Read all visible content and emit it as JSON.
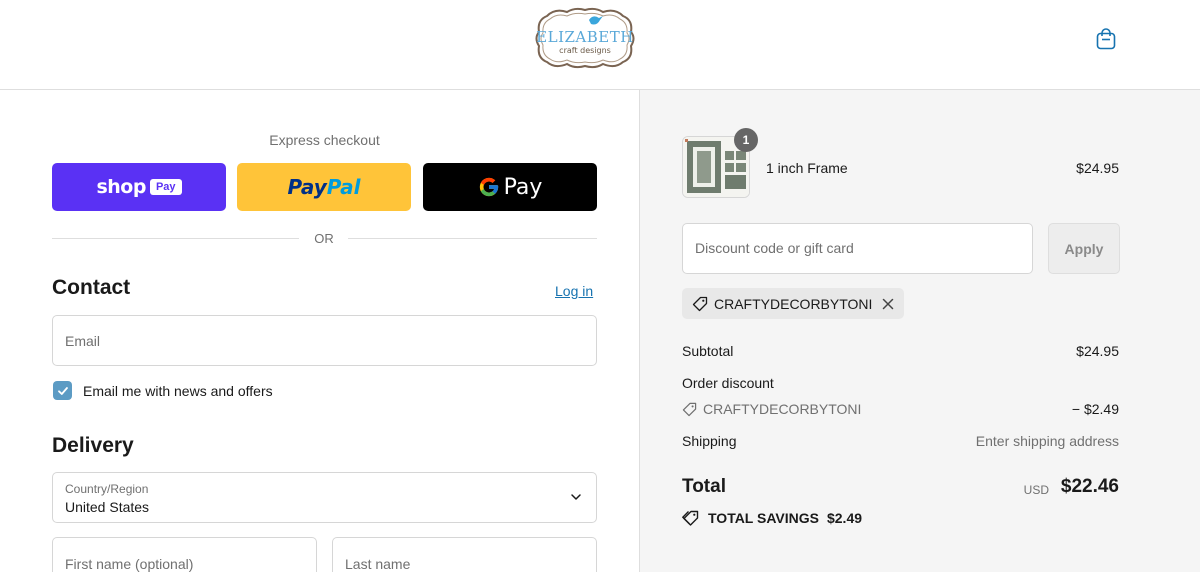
{
  "header": {
    "logo_text": "ELIZABETH",
    "logo_subtext": "craft designs",
    "cart_icon": "shopping-bag-icon"
  },
  "express": {
    "title": "Express checkout",
    "shop_pay": {
      "word": "shop",
      "badge": "Pay",
      "color": "#5a31f4"
    },
    "paypal": {
      "part1": "Pay",
      "part2": "Pal",
      "color": "#ffc439"
    },
    "gpay": {
      "label": "Pay",
      "color": "#000000"
    },
    "or_text": "OR"
  },
  "contact": {
    "title": "Contact",
    "login_label": "Log in",
    "email_placeholder": "Email",
    "newsletter_label": "Email me with news and offers",
    "newsletter_checked": true
  },
  "delivery": {
    "title": "Delivery",
    "country_label": "Country/Region",
    "country_value": "United States",
    "first_name_placeholder": "First name (optional)",
    "last_name_placeholder": "Last name"
  },
  "order": {
    "item": {
      "name": "1 inch Frame",
      "price": "$24.95",
      "quantity": "1"
    },
    "discount_placeholder": "Discount code or gift card",
    "apply_label": "Apply",
    "applied_code": "CRAFTYDECORBYTONI",
    "subtotal_label": "Subtotal",
    "subtotal_value": "$24.95",
    "order_discount_label": "Order discount",
    "discount_code": "CRAFTYDECORBYTONI",
    "discount_value": "− $2.49",
    "shipping_label": "Shipping",
    "shipping_value": "Enter shipping address",
    "total_label": "Total",
    "total_currency": "USD",
    "total_value": "$22.46",
    "savings_label": "TOTAL SAVINGS",
    "savings_value": "$2.49"
  },
  "colors": {
    "accent_link": "#1773b0",
    "checkbox": "#5c9bc4",
    "summary_bg": "#f5f5f5"
  }
}
